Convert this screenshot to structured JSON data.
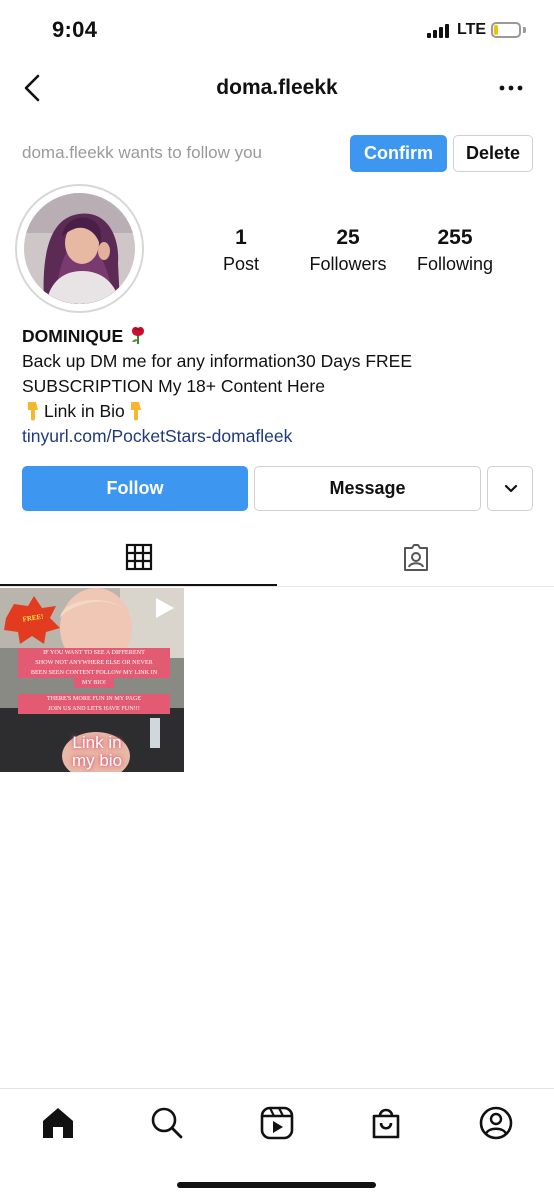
{
  "status_bar": {
    "time": "9:04",
    "network": "LTE"
  },
  "header": {
    "title": "doma.fleekk"
  },
  "follow_request": {
    "text": "doma.fleekk wants to follow you",
    "confirm_label": "Confirm",
    "delete_label": "Delete"
  },
  "stats": {
    "posts": {
      "count": "1",
      "label": "Post"
    },
    "followers": {
      "count": "25",
      "label": "Followers"
    },
    "following": {
      "count": "255",
      "label": "Following"
    }
  },
  "bio": {
    "name": "DOMINIQUE",
    "line1": "Back up DM me for any information30 Days FREE SUBSCRIPTION My 18+ Content Here",
    "link_line": "Link in Bio",
    "url": "tinyurl.com/PocketStars-domafleek"
  },
  "actions": {
    "follow_label": "Follow",
    "message_label": "Message"
  },
  "tabs": [
    {
      "icon": "grid-icon",
      "active": true
    },
    {
      "icon": "tagged-icon",
      "active": false
    }
  ],
  "post": {
    "badge": "FREE!",
    "line1": "IF YOU WANT TO SEE A DIFFERENT",
    "line2": "SHOW NOT ANYWHERE ELSE OR NEVER",
    "line3": "BEEN SEEN CONTENT FOLLOW MY LINK IN",
    "line4": "MY BIO!",
    "line5": "THERE'S MORE FUN IN MY PAGE",
    "line6": "JOIN US AND LETS HAVE FUN!!!",
    "link1": "Link in",
    "link2": "my bio"
  },
  "bottom_nav": [
    "home-icon",
    "search-icon",
    "reels-icon",
    "shop-icon",
    "profile-icon"
  ],
  "colors": {
    "accent": "#3d96f0",
    "link": "#1e3a7a",
    "muted": "#9a9a9a"
  }
}
